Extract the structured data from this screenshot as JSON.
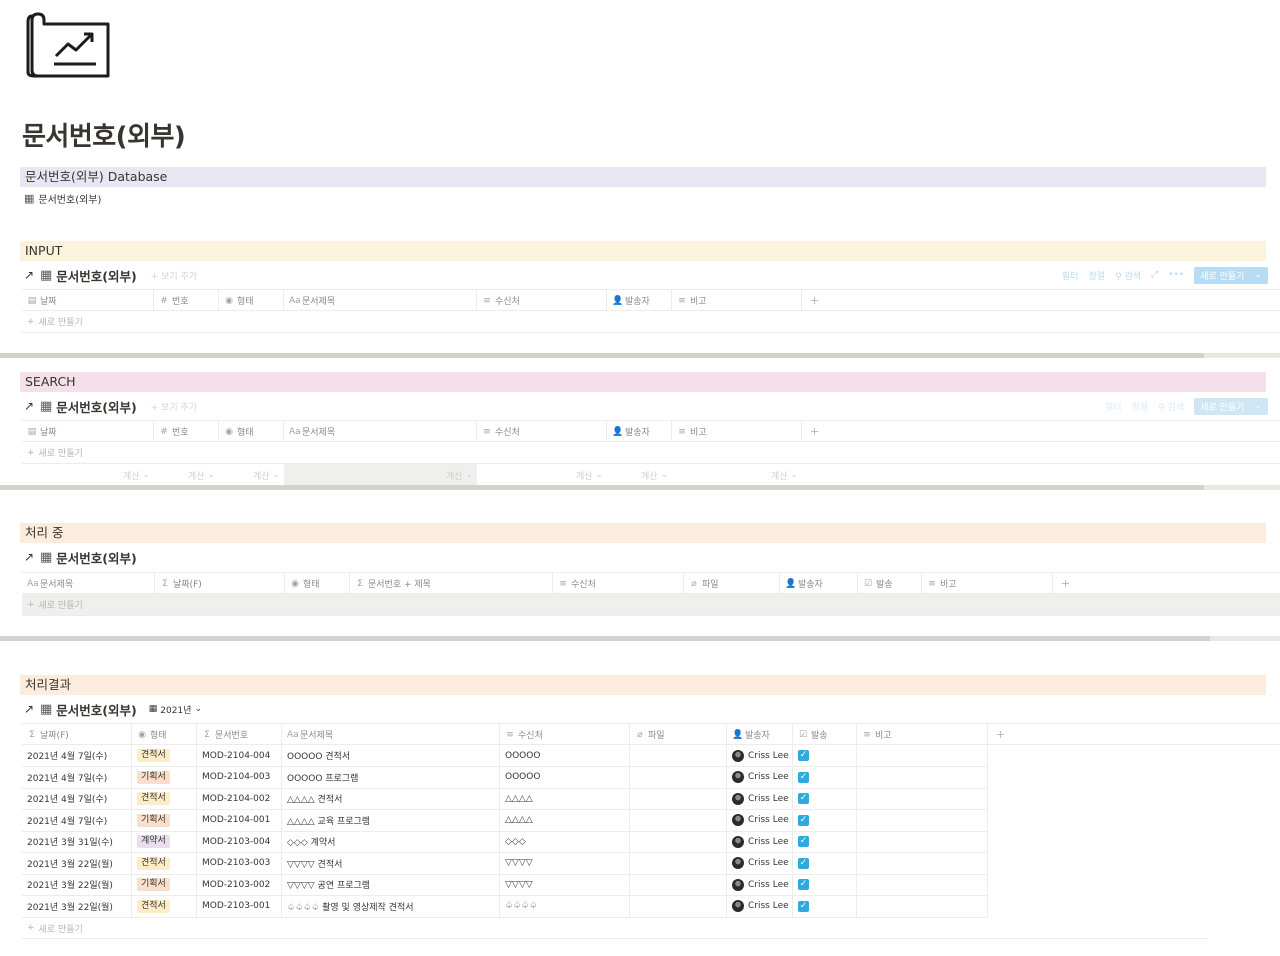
{
  "page": {
    "icon": "roadmap-chart-icon",
    "title": "문서번호(외부)"
  },
  "colors": {
    "purple_bg": "#e9e5f3",
    "yellow_bg": "#fbf3db",
    "pink_bg": "#f4dfeb",
    "orange_bg": "#fbecdd",
    "accent_blue": "#2eaadc"
  },
  "sections": {
    "database": {
      "header": "문서번호(외부) Database",
      "link": "문서번호(외부)"
    },
    "input": {
      "header": "INPUT",
      "db_title": "문서번호(외부)",
      "add_view": "+ 보기 추가",
      "toolbar": {
        "filter": "필터",
        "sort": "정렬",
        "search": "검색",
        "expand": "⤢",
        "more": "•••",
        "new": "새로 만들기"
      },
      "columns": [
        "날짜",
        "번호",
        "형태",
        "문서제목",
        "수신처",
        "발송자",
        "비고"
      ],
      "new_row": "새로 만들기"
    },
    "search": {
      "header": "SEARCH",
      "db_title": "문서번호(외부)",
      "add_view": "+ 보기 추가",
      "toolbar": {
        "filter": "필터",
        "sort": "정렬",
        "search": "검색",
        "new": "새로 만들기"
      },
      "columns": [
        "날짜",
        "번호",
        "형태",
        "문서제목",
        "수신처",
        "발송자",
        "비고"
      ],
      "new_row": "새로 만들기",
      "calc_label": "계산"
    },
    "processing": {
      "header": "처리 중",
      "db_title": "문서번호(외부)",
      "columns": [
        "문서제목",
        "날짜(F)",
        "형태",
        "문서번호 + 제목",
        "수신처",
        "파일",
        "발송자",
        "발송",
        "비고"
      ],
      "new_row": "새로 만들기"
    },
    "results": {
      "header": "처리결과",
      "db_title": "문서번호(외부)",
      "view_label": "2021년",
      "columns": [
        "날짜(F)",
        "형태",
        "문서번호",
        "문서제목",
        "수신처",
        "파일",
        "발송자",
        "발송",
        "비고"
      ],
      "rows": [
        {
          "date": "2021년 4월 7일(수)",
          "type": "견적서",
          "type_color": "#fdecc8",
          "number": "MOD-2104-004",
          "title": "OOOOO 견적서",
          "recipient": "OOOOO",
          "sender": "Criss Lee"
        },
        {
          "date": "2021년 4월 7일(수)",
          "type": "기획서",
          "type_color": "#fadec9",
          "number": "MOD-2104-003",
          "title": "OOOOO 프로그램",
          "recipient": "OOOOO",
          "sender": "Criss Lee"
        },
        {
          "date": "2021년 4월 7일(수)",
          "type": "견적서",
          "type_color": "#fdecc8",
          "number": "MOD-2104-002",
          "title": "△△△△ 견적서",
          "recipient": "△△△△",
          "sender": "Criss Lee"
        },
        {
          "date": "2021년 4월 7일(수)",
          "type": "기획서",
          "type_color": "#fadec9",
          "number": "MOD-2104-001",
          "title": "△△△△ 교육 프로그램",
          "recipient": "△△△△",
          "sender": "Criss Lee"
        },
        {
          "date": "2021년 3월 31일(수)",
          "type": "계약서",
          "type_color": "#e8deee",
          "number": "MOD-2103-004",
          "title": "◇◇◇ 계약서",
          "recipient": "◇◇◇",
          "sender": "Criss Lee"
        },
        {
          "date": "2021년 3월 22일(월)",
          "type": "견적서",
          "type_color": "#fdecc8",
          "number": "MOD-2103-003",
          "title": "▽▽▽▽ 견적서",
          "recipient": "▽▽▽▽",
          "sender": "Criss Lee"
        },
        {
          "date": "2021년 3월 22일(월)",
          "type": "기획서",
          "type_color": "#fadec9",
          "number": "MOD-2103-002",
          "title": "▽▽▽▽ 공연 프로그램",
          "recipient": "▽▽▽▽",
          "sender": "Criss Lee"
        },
        {
          "date": "2021년 3월 22일(월)",
          "type": "견적서",
          "type_color": "#fdecc8",
          "number": "MOD-2103-001",
          "title": "♤♤♤♤ 촬영 및 영상제작 견적서",
          "recipient": "♤♤♤♤",
          "sender": "Criss Lee"
        }
      ],
      "new_row": "새로 만들기"
    }
  }
}
